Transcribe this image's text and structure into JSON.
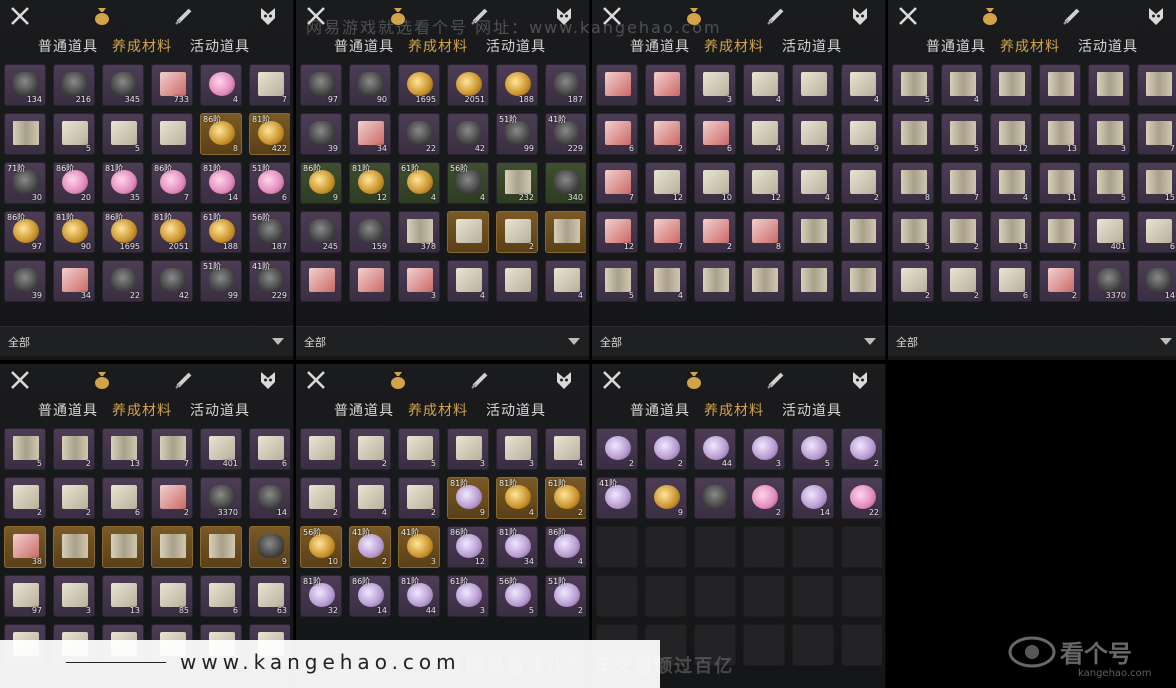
{
  "watermarks": {
    "top": "网易游戏就选看个号    网址：www.kangehao.com",
    "middle": "看个号专业网易游戏八年    年交易额过百亿",
    "banner": "www.kangehao.com",
    "logo_title": "看个号",
    "logo_sub": "kangehao.com"
  },
  "tabs": [
    "普通道具",
    "养成材料",
    "活动道具"
  ],
  "filter_label": "全部",
  "accent_color": "#d3a34a",
  "panels": [
    {
      "id": "p1",
      "slots": [
        {
          "art": "ore",
          "q": "134",
          "c": "purple"
        },
        {
          "art": "ore",
          "q": "216",
          "c": "purple"
        },
        {
          "art": "ore",
          "q": "345",
          "c": "purple"
        },
        {
          "art": "red",
          "q": "733",
          "c": "purple"
        },
        {
          "art": "pink",
          "q": "4",
          "c": "purple"
        },
        {
          "art": "scroll",
          "q": "7",
          "c": "purple"
        },
        {
          "art": "book",
          "q": "",
          "c": "purple"
        },
        {
          "art": "scroll",
          "q": "5",
          "c": "purple"
        },
        {
          "art": "scroll",
          "q": "5",
          "c": "purple"
        },
        {
          "art": "scroll",
          "q": "",
          "c": "purple"
        },
        {
          "art": "gold",
          "q": "8",
          "c": "gold",
          "l": "86阶"
        },
        {
          "art": "gold",
          "q": "422",
          "c": "gold",
          "l": "81阶"
        },
        {
          "art": "ore",
          "q": "30",
          "c": "purple",
          "l": "71阶"
        },
        {
          "art": "pink",
          "q": "20",
          "c": "purple",
          "l": "86阶"
        },
        {
          "art": "pink",
          "q": "35",
          "c": "purple",
          "l": "81阶"
        },
        {
          "art": "pink",
          "q": "7",
          "c": "purple",
          "l": "86阶"
        },
        {
          "art": "pink",
          "q": "14",
          "c": "purple",
          "l": "81阶"
        },
        {
          "art": "pink",
          "q": "6",
          "c": "purple",
          "l": "51阶"
        },
        {
          "art": "gold",
          "q": "97",
          "c": "purple",
          "l": "86阶"
        },
        {
          "art": "gold",
          "q": "90",
          "c": "purple",
          "l": "81阶"
        },
        {
          "art": "gold",
          "q": "1695",
          "c": "purple",
          "l": "86阶"
        },
        {
          "art": "gold",
          "q": "2051",
          "c": "purple",
          "l": "81阶"
        },
        {
          "art": "gold",
          "q": "188",
          "c": "purple",
          "l": "61阶"
        },
        {
          "art": "ore",
          "q": "187",
          "c": "purple",
          "l": "56阶"
        },
        {
          "art": "ore",
          "q": "39",
          "c": "purple"
        },
        {
          "art": "red",
          "q": "34",
          "c": "purple"
        },
        {
          "art": "ore",
          "q": "22",
          "c": "purple"
        },
        {
          "art": "ore",
          "q": "42",
          "c": "purple"
        },
        {
          "art": "ore",
          "q": "99",
          "c": "purple",
          "l": "51阶"
        },
        {
          "art": "ore",
          "q": "229",
          "c": "purple",
          "l": "41阶"
        }
      ]
    },
    {
      "id": "p2",
      "slots": [
        {
          "art": "ore",
          "q": "97",
          "c": "purple"
        },
        {
          "art": "ore",
          "q": "90",
          "c": "purple"
        },
        {
          "art": "gold",
          "q": "1695",
          "c": "purple"
        },
        {
          "art": "gold",
          "q": "2051",
          "c": "purple"
        },
        {
          "art": "gold",
          "q": "188",
          "c": "purple"
        },
        {
          "art": "ore",
          "q": "187",
          "c": "purple"
        },
        {
          "art": "ore",
          "q": "39",
          "c": "purple"
        },
        {
          "art": "red",
          "q": "34",
          "c": "purple"
        },
        {
          "art": "ore",
          "q": "22",
          "c": "purple"
        },
        {
          "art": "ore",
          "q": "42",
          "c": "purple"
        },
        {
          "art": "ore",
          "q": "99",
          "c": "purple",
          "l": "51阶"
        },
        {
          "art": "ore",
          "q": "229",
          "c": "purple",
          "l": "41阶"
        },
        {
          "art": "gold",
          "q": "9",
          "c": "green",
          "l": "86阶"
        },
        {
          "art": "gold",
          "q": "12",
          "c": "green",
          "l": "81阶"
        },
        {
          "art": "gold",
          "q": "4",
          "c": "green",
          "l": "61阶"
        },
        {
          "art": "ore",
          "q": "4",
          "c": "green",
          "l": "56阶"
        },
        {
          "art": "book",
          "q": "232",
          "c": "green"
        },
        {
          "art": "ore",
          "q": "340",
          "c": "green"
        },
        {
          "art": "ore",
          "q": "245",
          "c": "purple"
        },
        {
          "art": "ore",
          "q": "159",
          "c": "purple"
        },
        {
          "art": "book",
          "q": "378",
          "c": "purple"
        },
        {
          "art": "scroll",
          "q": "",
          "c": "gold"
        },
        {
          "art": "scroll",
          "q": "2",
          "c": "gold"
        },
        {
          "art": "book",
          "q": "",
          "c": "gold"
        },
        {
          "art": "red",
          "q": "",
          "c": "purple"
        },
        {
          "art": "red",
          "q": "",
          "c": "purple"
        },
        {
          "art": "red",
          "q": "3",
          "c": "purple"
        },
        {
          "art": "scroll",
          "q": "4",
          "c": "purple"
        },
        {
          "art": "scroll",
          "q": "",
          "c": "purple"
        },
        {
          "art": "scroll",
          "q": "4",
          "c": "purple"
        }
      ]
    },
    {
      "id": "p3",
      "slots": [
        {
          "art": "red",
          "q": "",
          "c": "purple"
        },
        {
          "art": "red",
          "q": "",
          "c": "purple"
        },
        {
          "art": "scroll",
          "q": "3",
          "c": "purple"
        },
        {
          "art": "scroll",
          "q": "4",
          "c": "purple"
        },
        {
          "art": "scroll",
          "q": "",
          "c": "purple"
        },
        {
          "art": "scroll",
          "q": "4",
          "c": "purple"
        },
        {
          "art": "red",
          "q": "6",
          "c": "purple"
        },
        {
          "art": "red",
          "q": "2",
          "c": "purple"
        },
        {
          "art": "red",
          "q": "6",
          "c": "purple"
        },
        {
          "art": "scroll",
          "q": "4",
          "c": "purple"
        },
        {
          "art": "scroll",
          "q": "7",
          "c": "purple"
        },
        {
          "art": "scroll",
          "q": "9",
          "c": "purple"
        },
        {
          "art": "red",
          "q": "7",
          "c": "purple"
        },
        {
          "art": "scroll",
          "q": "12",
          "c": "purple"
        },
        {
          "art": "scroll",
          "q": "10",
          "c": "purple"
        },
        {
          "art": "scroll",
          "q": "12",
          "c": "purple"
        },
        {
          "art": "scroll",
          "q": "4",
          "c": "purple"
        },
        {
          "art": "scroll",
          "q": "2",
          "c": "purple"
        },
        {
          "art": "red",
          "q": "12",
          "c": "purple"
        },
        {
          "art": "red",
          "q": "7",
          "c": "purple"
        },
        {
          "art": "red",
          "q": "2",
          "c": "purple"
        },
        {
          "art": "red",
          "q": "8",
          "c": "purple"
        },
        {
          "art": "book",
          "q": "",
          "c": "purple"
        },
        {
          "art": "book",
          "q": "",
          "c": "purple"
        },
        {
          "art": "book",
          "q": "5",
          "c": "purple"
        },
        {
          "art": "book",
          "q": "4",
          "c": "purple"
        },
        {
          "art": "book",
          "q": "",
          "c": "purple"
        },
        {
          "art": "book",
          "q": "",
          "c": "purple"
        },
        {
          "art": "book",
          "q": "",
          "c": "purple"
        },
        {
          "art": "book",
          "q": "",
          "c": "purple"
        }
      ]
    },
    {
      "id": "p4",
      "slots": [
        {
          "art": "book",
          "q": "5",
          "c": "purple"
        },
        {
          "art": "book",
          "q": "4",
          "c": "purple"
        },
        {
          "art": "book",
          "q": "",
          "c": "purple"
        },
        {
          "art": "book",
          "q": "",
          "c": "purple"
        },
        {
          "art": "book",
          "q": "",
          "c": "purple"
        },
        {
          "art": "book",
          "q": "",
          "c": "purple"
        },
        {
          "art": "book",
          "q": "",
          "c": "purple"
        },
        {
          "art": "book",
          "q": "5",
          "c": "purple"
        },
        {
          "art": "book",
          "q": "12",
          "c": "purple"
        },
        {
          "art": "book",
          "q": "13",
          "c": "purple"
        },
        {
          "art": "book",
          "q": "3",
          "c": "purple"
        },
        {
          "art": "book",
          "q": "7",
          "c": "purple"
        },
        {
          "art": "book",
          "q": "8",
          "c": "purple"
        },
        {
          "art": "book",
          "q": "7",
          "c": "purple"
        },
        {
          "art": "book",
          "q": "4",
          "c": "purple"
        },
        {
          "art": "book",
          "q": "11",
          "c": "purple"
        },
        {
          "art": "book",
          "q": "5",
          "c": "purple"
        },
        {
          "art": "book",
          "q": "15",
          "c": "purple"
        },
        {
          "art": "book",
          "q": "5",
          "c": "purple"
        },
        {
          "art": "book",
          "q": "2",
          "c": "purple"
        },
        {
          "art": "book",
          "q": "13",
          "c": "purple"
        },
        {
          "art": "book",
          "q": "7",
          "c": "purple"
        },
        {
          "art": "scroll",
          "q": "401",
          "c": "purple"
        },
        {
          "art": "scroll",
          "q": "6",
          "c": "purple"
        },
        {
          "art": "scroll",
          "q": "2",
          "c": "purple"
        },
        {
          "art": "scroll",
          "q": "2",
          "c": "purple"
        },
        {
          "art": "scroll",
          "q": "6",
          "c": "purple"
        },
        {
          "art": "red",
          "q": "2",
          "c": "purple"
        },
        {
          "art": "ore",
          "q": "3370",
          "c": "purple"
        },
        {
          "art": "ore",
          "q": "14",
          "c": "purple"
        }
      ]
    },
    {
      "id": "p5",
      "slots": [
        {
          "art": "book",
          "q": "5",
          "c": "purple"
        },
        {
          "art": "book",
          "q": "2",
          "c": "purple"
        },
        {
          "art": "book",
          "q": "13",
          "c": "purple"
        },
        {
          "art": "book",
          "q": "7",
          "c": "purple"
        },
        {
          "art": "scroll",
          "q": "401",
          "c": "purple"
        },
        {
          "art": "scroll",
          "q": "6",
          "c": "purple"
        },
        {
          "art": "scroll",
          "q": "2",
          "c": "purple"
        },
        {
          "art": "scroll",
          "q": "2",
          "c": "purple"
        },
        {
          "art": "scroll",
          "q": "6",
          "c": "purple"
        },
        {
          "art": "red",
          "q": "2",
          "c": "purple"
        },
        {
          "art": "ore",
          "q": "3370",
          "c": "purple"
        },
        {
          "art": "ore",
          "q": "14",
          "c": "purple"
        },
        {
          "art": "red",
          "q": "38",
          "c": "gold"
        },
        {
          "art": "book",
          "q": "",
          "c": "gold"
        },
        {
          "art": "book",
          "q": "",
          "c": "gold"
        },
        {
          "art": "book",
          "q": "",
          "c": "gold"
        },
        {
          "art": "book",
          "q": "",
          "c": "gold"
        },
        {
          "art": "ore",
          "q": "9",
          "c": "gold"
        },
        {
          "art": "scroll",
          "q": "97",
          "c": "purple"
        },
        {
          "art": "scroll",
          "q": "3",
          "c": "purple"
        },
        {
          "art": "scroll",
          "q": "13",
          "c": "purple"
        },
        {
          "art": "scroll",
          "q": "85",
          "c": "purple"
        },
        {
          "art": "scroll",
          "q": "6",
          "c": "purple"
        },
        {
          "art": "scroll",
          "q": "63",
          "c": "purple"
        },
        {
          "art": "scroll",
          "q": "",
          "c": "purple"
        },
        {
          "art": "scroll",
          "q": "",
          "c": "purple"
        },
        {
          "art": "scroll",
          "q": "",
          "c": "purple"
        },
        {
          "art": "scroll",
          "q": "",
          "c": "purple"
        },
        {
          "art": "scroll",
          "q": "",
          "c": "purple"
        },
        {
          "art": "scroll",
          "q": "",
          "c": "purple"
        }
      ]
    },
    {
      "id": "p6",
      "slots": [
        {
          "art": "scroll",
          "q": "",
          "c": "purple"
        },
        {
          "art": "scroll",
          "q": "2",
          "c": "purple"
        },
        {
          "art": "scroll",
          "q": "5",
          "c": "purple"
        },
        {
          "art": "scroll",
          "q": "3",
          "c": "purple"
        },
        {
          "art": "scroll",
          "q": "3",
          "c": "purple"
        },
        {
          "art": "scroll",
          "q": "4",
          "c": "purple"
        },
        {
          "art": "scroll",
          "q": "2",
          "c": "purple"
        },
        {
          "art": "scroll",
          "q": "4",
          "c": "purple"
        },
        {
          "art": "scroll",
          "q": "2",
          "c": "purple"
        },
        {
          "art": "shell",
          "q": "9",
          "c": "gold",
          "l": "81阶"
        },
        {
          "art": "gold",
          "q": "4",
          "c": "gold",
          "l": "81阶"
        },
        {
          "art": "gold",
          "q": "2",
          "c": "gold",
          "l": "61阶"
        },
        {
          "art": "gold",
          "q": "10",
          "c": "gold",
          "l": "56阶"
        },
        {
          "art": "shell",
          "q": "2",
          "c": "gold",
          "l": "41阶"
        },
        {
          "art": "gold",
          "q": "3",
          "c": "gold",
          "l": "41阶"
        },
        {
          "art": "shell",
          "q": "12",
          "c": "purple",
          "l": "86阶"
        },
        {
          "art": "shell",
          "q": "34",
          "c": "purple",
          "l": "81阶"
        },
        {
          "art": "shell",
          "q": "4",
          "c": "purple",
          "l": "86阶"
        },
        {
          "art": "shell",
          "q": "32",
          "c": "purple",
          "l": "81阶"
        },
        {
          "art": "shell",
          "q": "14",
          "c": "purple",
          "l": "86阶"
        },
        {
          "art": "shell",
          "q": "44",
          "c": "purple",
          "l": "81阶"
        },
        {
          "art": "shell",
          "q": "3",
          "c": "purple",
          "l": "61阶"
        },
        {
          "art": "shell",
          "q": "5",
          "c": "purple",
          "l": "56阶"
        },
        {
          "art": "shell",
          "q": "2",
          "c": "purple",
          "l": "51阶"
        }
      ]
    },
    {
      "id": "p7",
      "slots": [
        {
          "art": "shell",
          "q": "2",
          "c": "purple"
        },
        {
          "art": "shell",
          "q": "2",
          "c": "purple"
        },
        {
          "art": "shell",
          "q": "44",
          "c": "purple"
        },
        {
          "art": "shell",
          "q": "3",
          "c": "purple"
        },
        {
          "art": "shell",
          "q": "5",
          "c": "purple"
        },
        {
          "art": "shell",
          "q": "2",
          "c": "purple"
        },
        {
          "art": "shell",
          "q": "",
          "c": "purple",
          "l": "41阶"
        },
        {
          "art": "gold",
          "q": "9",
          "c": "purple"
        },
        {
          "art": "ore",
          "q": "",
          "c": "purple"
        },
        {
          "art": "pink",
          "q": "2",
          "c": "purple"
        },
        {
          "art": "shell",
          "q": "14",
          "c": "purple"
        },
        {
          "art": "pink",
          "q": "22",
          "c": "purple"
        },
        {
          "art": "",
          "q": "",
          "c": "empty"
        },
        {
          "art": "",
          "q": "",
          "c": "empty"
        },
        {
          "art": "",
          "q": "",
          "c": "empty"
        },
        {
          "art": "",
          "q": "",
          "c": "empty"
        },
        {
          "art": "",
          "q": "",
          "c": "empty"
        },
        {
          "art": "",
          "q": "",
          "c": "empty"
        },
        {
          "art": "",
          "q": "",
          "c": "empty"
        },
        {
          "art": "",
          "q": "",
          "c": "empty"
        },
        {
          "art": "",
          "q": "",
          "c": "empty"
        },
        {
          "art": "",
          "q": "",
          "c": "empty"
        },
        {
          "art": "",
          "q": "",
          "c": "empty"
        },
        {
          "art": "",
          "q": "",
          "c": "empty"
        },
        {
          "art": "",
          "q": "",
          "c": "empty"
        },
        {
          "art": "",
          "q": "",
          "c": "empty"
        },
        {
          "art": "",
          "q": "",
          "c": "empty"
        },
        {
          "art": "",
          "q": "",
          "c": "empty"
        },
        {
          "art": "",
          "q": "",
          "c": "empty"
        },
        {
          "art": "",
          "q": "",
          "c": "empty"
        }
      ]
    }
  ]
}
